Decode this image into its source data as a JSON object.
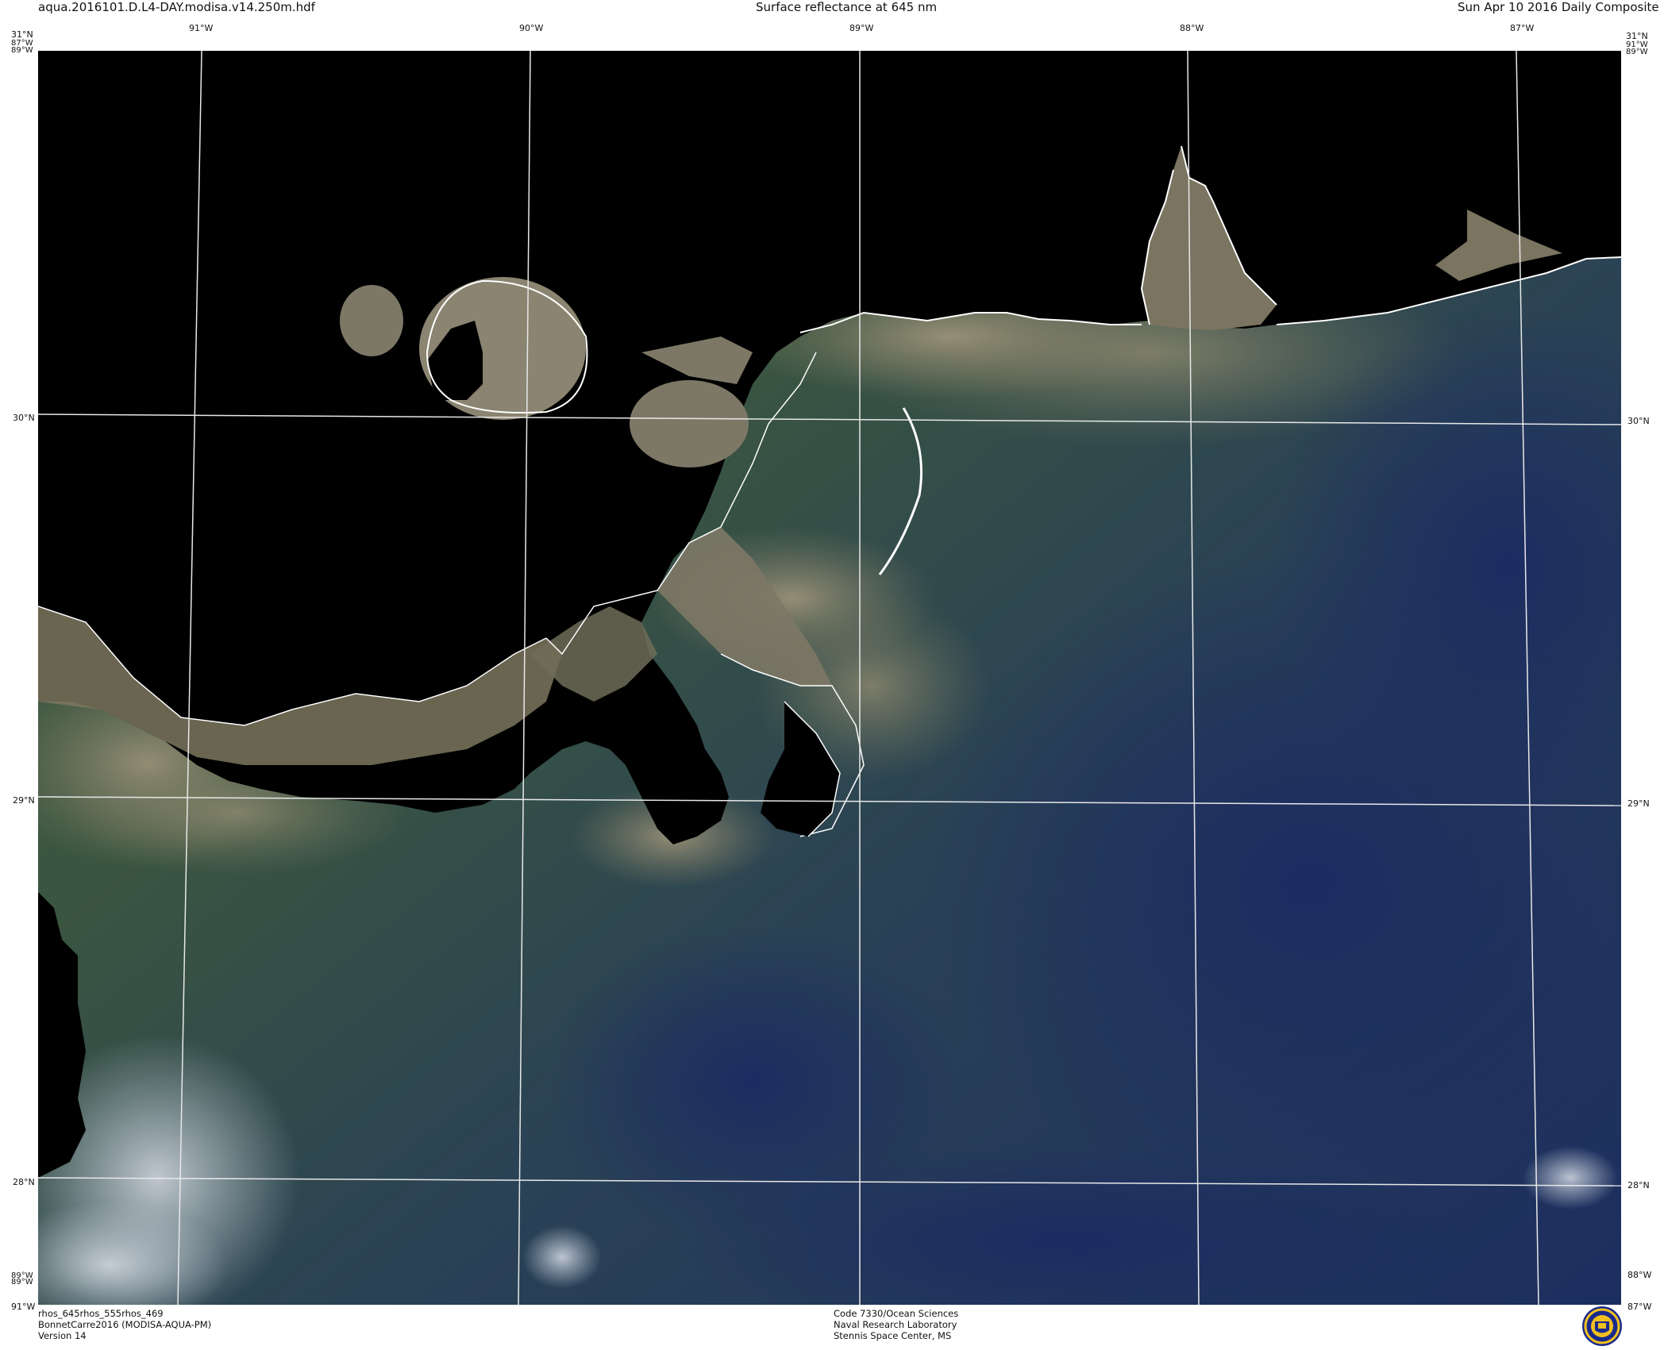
{
  "header": {
    "filename": "aqua.2016101.D.L4-DAY.modisa.v14.250m.hdf",
    "title": "Surface reflectance at 645 nm",
    "date": "Sun Apr 10 2016 Daily Composite"
  },
  "labels": {
    "top_lon": [
      "91°W",
      "90°W",
      "89°W",
      "88°W",
      "87°W"
    ],
    "left_lat": [
      "30°N",
      "29°N",
      "28°N"
    ],
    "right_lat": [
      "30°N",
      "29°N",
      "28°N"
    ],
    "corners": {
      "tl_lat": "31°N",
      "tl_lon1": "87°W",
      "tl_lon2": "89°W",
      "tr_lat": "31°N",
      "tr_lon1": "91°W",
      "tr_lon2": "89°W",
      "bl_lon1": "89°W",
      "bl_lon2": "89°W",
      "bl_lon3": "91°W",
      "br_lon1": "88°W",
      "br_lon2": "87°W"
    }
  },
  "footer": {
    "product": "rhos_645rhos_555rhos_469",
    "project": "BonnetCarre2016 (MODISA-AQUA-PM)",
    "version": "Version 14",
    "org_code": "Code 7330/Ocean Sciences",
    "org_name": "Naval Research Laboratory",
    "org_place": "Stennis Space Center, MS"
  },
  "colors": {
    "land_mask": "#000000",
    "graticule": "#e8e8e8",
    "coastline": "#ffffff",
    "sediment": "#8a8470",
    "turbid_green": "#3f5a3a",
    "deep_water": "#1e3260"
  },
  "logo_icon": "nrl-seal-icon"
}
